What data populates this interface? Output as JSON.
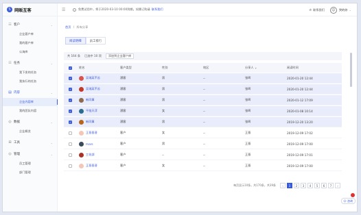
{
  "app": {
    "logo_text": "网販互客"
  },
  "topbar": {
    "notice": "免费试用中，将于2020-03-10 00:00到期。如需订购请",
    "notice_link": "联系我们",
    "contact": "联系我们",
    "user": "哭的你"
  },
  "sidebar": {
    "groups": [
      {
        "label": "客户",
        "icon": "☷",
        "items": [
          "企业客户库",
          "我的客户库",
          "公海库"
        ]
      },
      {
        "label": "任务",
        "icon": "☷",
        "items": [
          "我下发的任务",
          "我执行的任务"
        ]
      },
      {
        "label": "内容",
        "icon": "▤",
        "items": [
          "企业内容库",
          "我的团队内容"
        ]
      },
      {
        "label": "数据",
        "icon": "◎",
        "items": [
          "企业概览"
        ]
      },
      {
        "label": "工具",
        "icon": "⊞",
        "items": []
      },
      {
        "label": "管理",
        "icon": "◎",
        "items": [
          "员工管理",
          "部门管理"
        ]
      }
    ],
    "active_item": "企业内容库"
  },
  "breadcrumb": {
    "home": "首页",
    "sep": "/",
    "current": "所有分享"
  },
  "tabs": [
    "阅读明细",
    "员工排行"
  ],
  "selection": {
    "total": "共 164 条",
    "selected": "已选中 10 项",
    "add_button": "添加到企业客户库"
  },
  "table": {
    "headers": [
      "姓名",
      "客户类型",
      "性别",
      "地区",
      "分享人",
      "阅读时间"
    ],
    "rows": [
      {
        "sel": true,
        "avatar": "#d9534f",
        "name": "吴瑞英不苦",
        "type": "潜客",
        "gender": "男",
        "region": "--",
        "sharer": "张晖",
        "time": "2020-01-20 12:44"
      },
      {
        "sel": true,
        "avatar": "#c0392b",
        "name": "吴瑞英不苦",
        "type": "潜客",
        "gender": "男",
        "region": "--",
        "sharer": "张晖",
        "time": "2020-01-20 12:44"
      },
      {
        "sel": true,
        "avatar": "#8e6b4f",
        "name": "新同事",
        "type": "潜客",
        "gender": "男",
        "region": "--",
        "sharer": "张晖",
        "time": "2020-01-12 17:09"
      },
      {
        "sel": true,
        "avatar": "#2b6c8f",
        "name": "平凿天浮",
        "type": "潜客",
        "gender": "女",
        "region": "--",
        "sharer": "张晖",
        "time": "2020-01-08 10:14"
      },
      {
        "sel": true,
        "avatar": "#b5651d",
        "name": "新同事",
        "type": "潜客",
        "gender": "男",
        "region": "--",
        "sharer": "张晖",
        "time": "2019-12-20 13:20"
      },
      {
        "sel": false,
        "avatar": "#f3c7b7",
        "name": "王晋晋晋",
        "type": "客户",
        "gender": "女",
        "region": "--",
        "sharer": "王晋",
        "time": "2019-12-09 17:02"
      },
      {
        "sel": false,
        "avatar": "#3b4a5a",
        "name": "mars",
        "type": "客户",
        "gender": "男",
        "region": "--",
        "sharer": "王晋",
        "time": "2019-12-09 17:00"
      },
      {
        "sel": false,
        "avatar": "#a93226",
        "name": "三化部",
        "type": "客户",
        "gender": "--",
        "region": "--",
        "sharer": "王晋",
        "time": "2019-12-09 17:01"
      },
      {
        "sel": false,
        "avatar": "#f3c7b7",
        "name": "王晋晋晋",
        "type": "客户",
        "gender": "女",
        "region": "--",
        "sharer": "王晋",
        "time": "2019-12-09 17:00"
      }
    ]
  },
  "pager": {
    "summary": "每页显示10条，共170条，共39条",
    "pages": [
      "1",
      "2",
      "3",
      "4",
      "5",
      "6",
      "7"
    ],
    "current": "1",
    "prev": "‹",
    "next": "›"
  },
  "float_button": "☺ 咨询"
}
